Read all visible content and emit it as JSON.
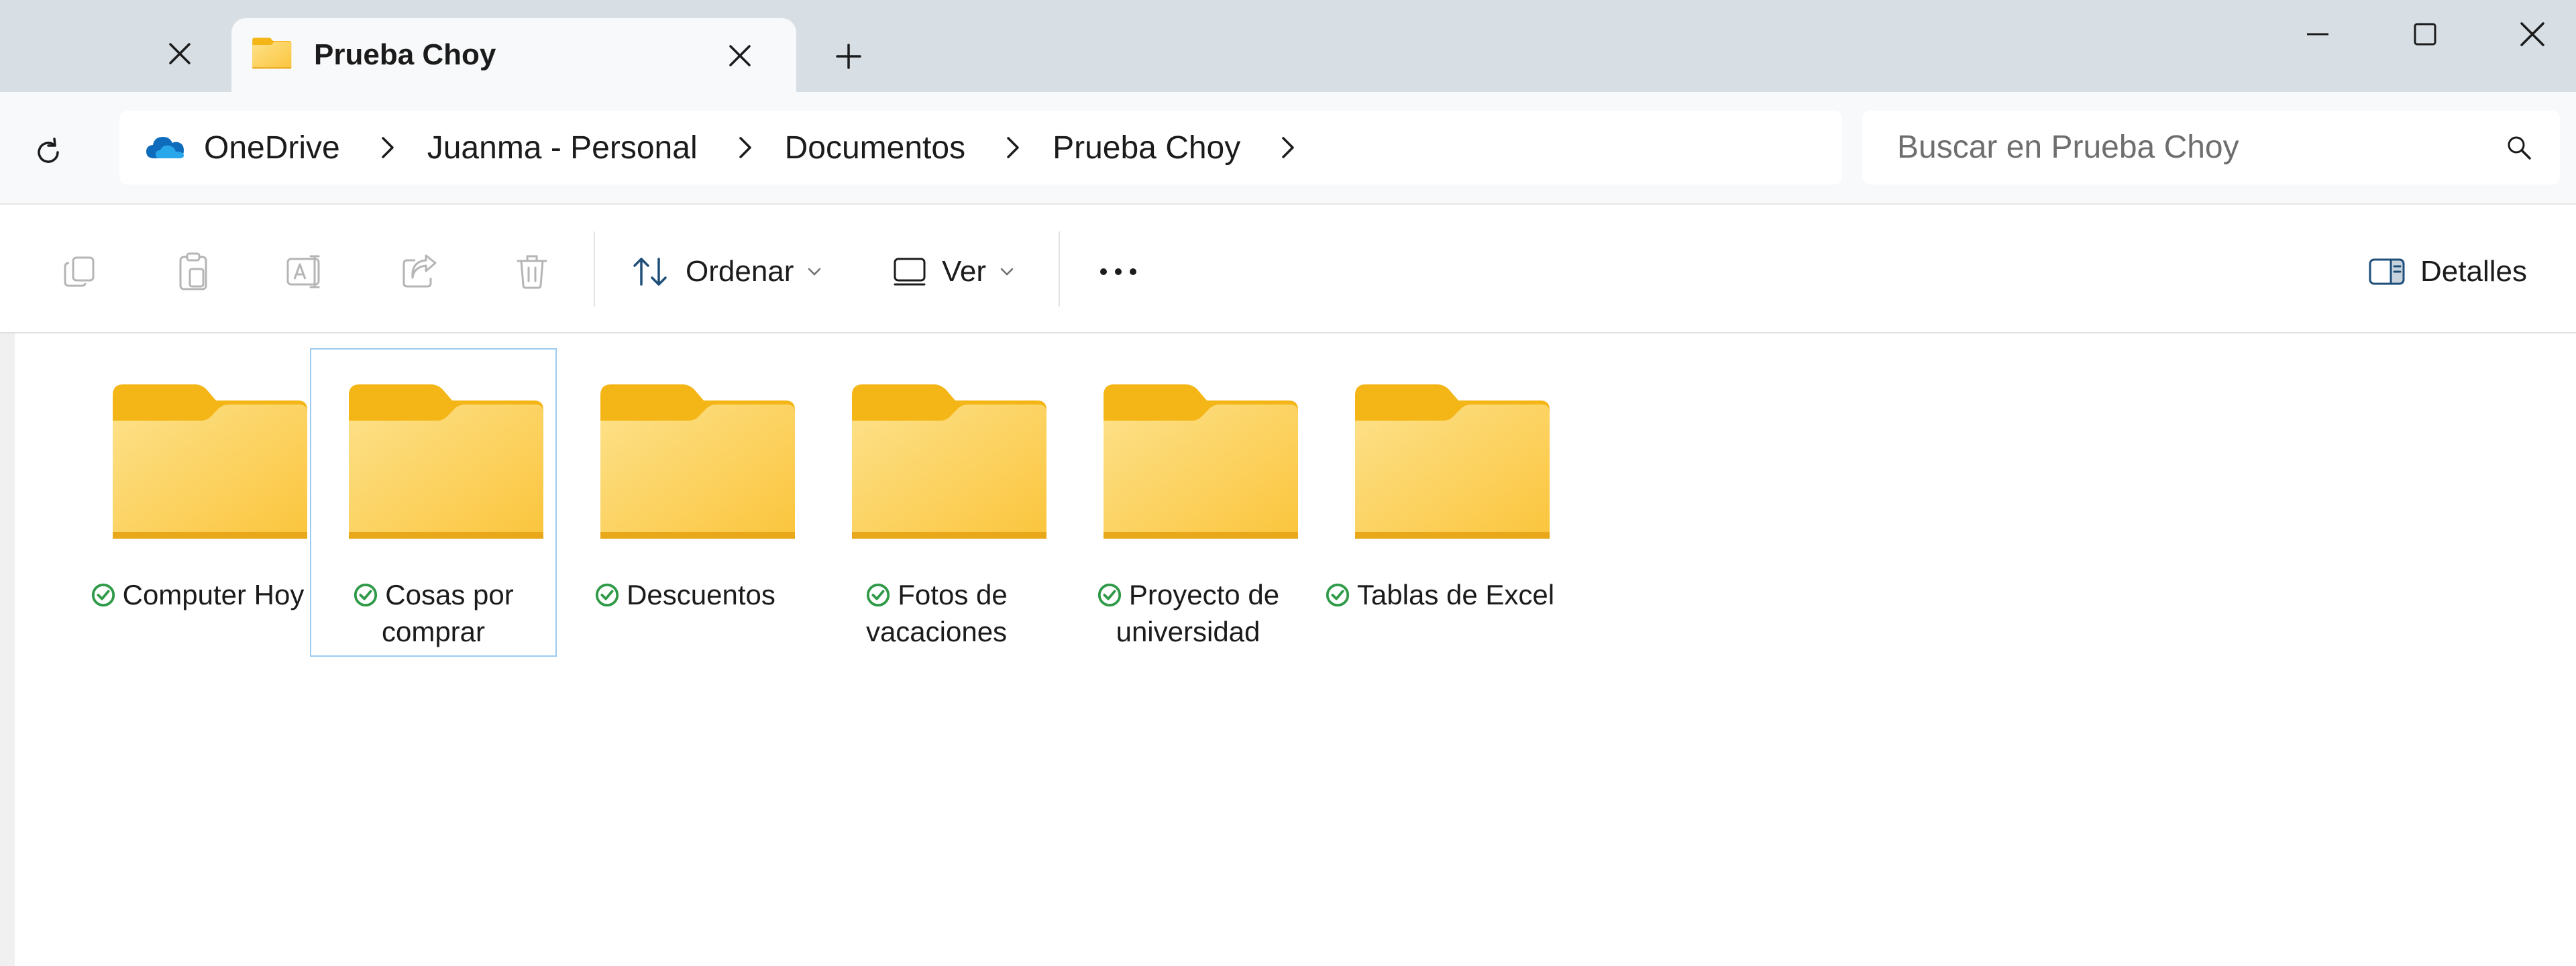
{
  "window": {
    "active_tab_label": "Prueba Choy"
  },
  "address": {
    "breadcrumbs": [
      "OneDrive",
      "Juanma - Personal",
      "Documentos",
      "Prueba Choy"
    ]
  },
  "search": {
    "placeholder": "Buscar en Prueba Choy"
  },
  "toolbar": {
    "sort_label": "Ordenar",
    "view_label": "Ver",
    "details_label": "Detalles"
  },
  "folders": [
    {
      "name_line1": "Computer Hoy",
      "name_line2": ""
    },
    {
      "name_line1": "Cosas por",
      "name_line2": "comprar"
    },
    {
      "name_line1": "Descuentos",
      "name_line2": ""
    },
    {
      "name_line1": "Fotos de",
      "name_line2": "vacaciones"
    },
    {
      "name_line1": "Proyecto de",
      "name_line2": "universidad"
    },
    {
      "name_line1": "Tablas de Excel",
      "name_line2": ""
    }
  ],
  "colors": {
    "folder_back": "#f4b517",
    "folder_front": "#fcd55f",
    "sync_ok": "#2e9a47",
    "onedrive_blue": "#0f6cbd",
    "selection_border": "#9dcbf0"
  },
  "icons": [
    "close-icon",
    "folder-icon",
    "plus-icon",
    "minimize-icon",
    "maximize-icon",
    "refresh-icon",
    "onedrive-cloud-icon",
    "chevron-right-icon",
    "search-icon",
    "copy-icon",
    "paste-icon",
    "rename-icon",
    "share-icon",
    "delete-icon",
    "sort-icon",
    "view-icon",
    "more-icon",
    "details-pane-icon",
    "sync-check-icon"
  ]
}
